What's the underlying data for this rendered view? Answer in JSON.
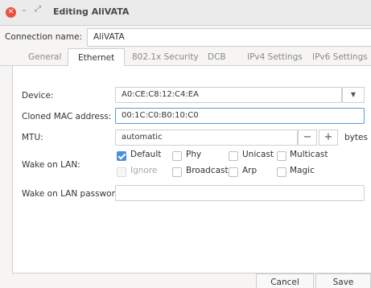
{
  "window": {
    "title": "Editing AliVATA"
  },
  "connection": {
    "label": "Connection name:",
    "value": "AliVATA"
  },
  "tabs": [
    "General",
    "Ethernet",
    "802.1x Security",
    "DCB",
    "IPv4 Settings",
    "IPv6 Settings"
  ],
  "active_tab": "Ethernet",
  "form": {
    "device_label": "Device:",
    "device_value": "A0:CE:C8:12:C4:EA",
    "cloned_mac_label": "Cloned MAC address:",
    "cloned_mac_value": "00:1C:C0:B0:10:C0",
    "mtu_label": "MTU:",
    "mtu_value": "automatic",
    "mtu_minus": "−",
    "mtu_plus": "+",
    "mtu_unit": "bytes",
    "wol_label": "Wake on LAN:",
    "wol_options": [
      {
        "label": "Default",
        "checked": true,
        "disabled": false
      },
      {
        "label": "Phy",
        "checked": false,
        "disabled": false
      },
      {
        "label": "Unicast",
        "checked": false,
        "disabled": false
      },
      {
        "label": "Multicast",
        "checked": false,
        "disabled": false
      },
      {
        "label": "Ignore",
        "checked": false,
        "disabled": true
      },
      {
        "label": "Broadcast",
        "checked": false,
        "disabled": false
      },
      {
        "label": "Arp",
        "checked": false,
        "disabled": false
      },
      {
        "label": "Magic",
        "checked": false,
        "disabled": false
      }
    ],
    "wol_password_label": "Wake on LAN password:",
    "wol_password_value": ""
  },
  "buttons": {
    "cancel": "Cancel",
    "save": "Save"
  },
  "icons": {
    "close": "close-icon",
    "minimize": "minimize-icon",
    "maximize": "maximize-icon",
    "dropdown": "chevron-down-icon"
  },
  "colors": {
    "close": "#e9513f",
    "accent": "#4a90d9",
    "focus": "#5b9bd5"
  }
}
